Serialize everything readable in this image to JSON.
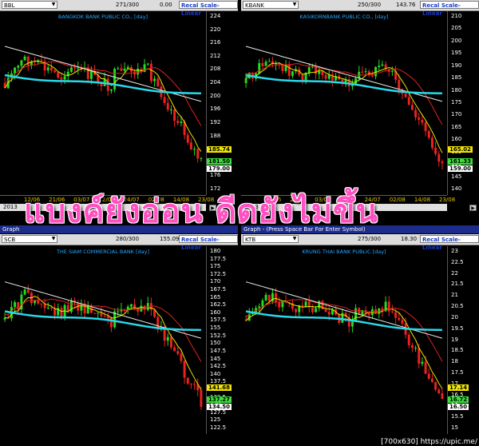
{
  "panes": [
    {
      "id": "bbl",
      "symbol": "BBL",
      "count": "271/300",
      "value": "0.00",
      "recal": "Recal Scale-Linear",
      "title": "BANGKOK BANK PUBLIC CO., [day]",
      "graph_label": "",
      "ticks": [
        "224",
        "220",
        "216",
        "212",
        "208",
        "204",
        "200",
        "196",
        "192",
        "188",
        "184",
        "180",
        "176",
        "172"
      ],
      "labels": [
        {
          "text": "185.74",
          "color": "#f2e600"
        },
        {
          "text": "181.50",
          "color": "#3ce03c"
        },
        {
          "text": "179.00",
          "color": "#ffffff"
        }
      ],
      "dates": [
        "12/06",
        "21/06",
        "03/07",
        "12/07",
        "24/07",
        "02/08",
        "14/08",
        "23/08"
      ],
      "dates_prefix": "Jul",
      "dates_aug": "Aug",
      "year": "2013",
      "mini": [
        "F",
        "U",
        "L",
        "L"
      ],
      "trend": "down"
    },
    {
      "id": "kbank",
      "symbol": "KBANK",
      "count": "250/300",
      "value": "143.76",
      "recal": "Recal Scale-Linear",
      "title": "KASIKORNBANK PUBLIC CO., [day]",
      "graph_label": "",
      "ticks": [
        "210",
        "205",
        "200",
        "195",
        "190",
        "185",
        "180",
        "175",
        "170",
        "165",
        "160",
        "155",
        "150",
        "145",
        "140"
      ],
      "labels": [
        {
          "text": "165.02",
          "color": "#f2e600"
        },
        {
          "text": "161.33",
          "color": "#3ce03c"
        },
        {
          "text": "159.00",
          "color": "#ffffff"
        }
      ],
      "dates": [
        "12/06",
        "21/06",
        "03/07",
        "12/07",
        "24/07",
        "02/08",
        "14/08",
        "23/08"
      ],
      "dates_prefix": "Jul",
      "dates_aug": "Aug",
      "year": "2013",
      "mini": [
        "F",
        "U",
        "L",
        "L"
      ],
      "trend": "down"
    },
    {
      "id": "scb",
      "symbol": "SCB",
      "count": "280/300",
      "value": "155.09",
      "recal": "Recal Scale-Linear",
      "title": "THE SIAM COMMERCIAL BANK [day]",
      "graph_label": "Graph",
      "ticks": [
        "180",
        "177.5",
        "175",
        "172.5",
        "170",
        "167.5",
        "165",
        "162.5",
        "160",
        "157.5",
        "155",
        "152.5",
        "150",
        "147.5",
        "145",
        "142.5",
        "140",
        "137.5",
        "135",
        "132.5",
        "130",
        "127.5",
        "125",
        "122.5"
      ],
      "labels": [
        {
          "text": "141.68",
          "color": "#f2e600"
        },
        {
          "text": "137.27",
          "color": "#3ce03c"
        },
        {
          "text": "134.50",
          "color": "#ffffff"
        }
      ],
      "trend": "down"
    },
    {
      "id": "ktb",
      "symbol": "KTB",
      "count": "275/300",
      "value": "18.30",
      "recal": "Recal Scale-Linear",
      "title": "KRUNG THAI BANK PUBLIC [day]",
      "graph_label": "Graph - (Press Space Bar For Enter Symbol)",
      "ticks": [
        "23",
        "22.5",
        "22",
        "21.5",
        "21",
        "20.5",
        "20",
        "19.5",
        "19",
        "18.5",
        "18",
        "17.5",
        "17",
        "16.5",
        "16",
        "15.5",
        "15"
      ],
      "labels": [
        {
          "text": "17.14",
          "color": "#f2e600"
        },
        {
          "text": "16.72",
          "color": "#3ce03c"
        },
        {
          "text": "16.50",
          "color": "#ffffff"
        }
      ],
      "trend": "down"
    }
  ],
  "watermark": "แบงค์ยังอ่อน ดีดยังไม่ขึ้น",
  "footer": "[700x630] https://upic.me/",
  "colors": {
    "up": "#22dd22",
    "down": "#ee2222",
    "ma_fast": "#e6e600",
    "ma_mid": "#dd2222",
    "ma_slow": "#e8e8e8",
    "ma_long": "#2ad8e8"
  }
}
